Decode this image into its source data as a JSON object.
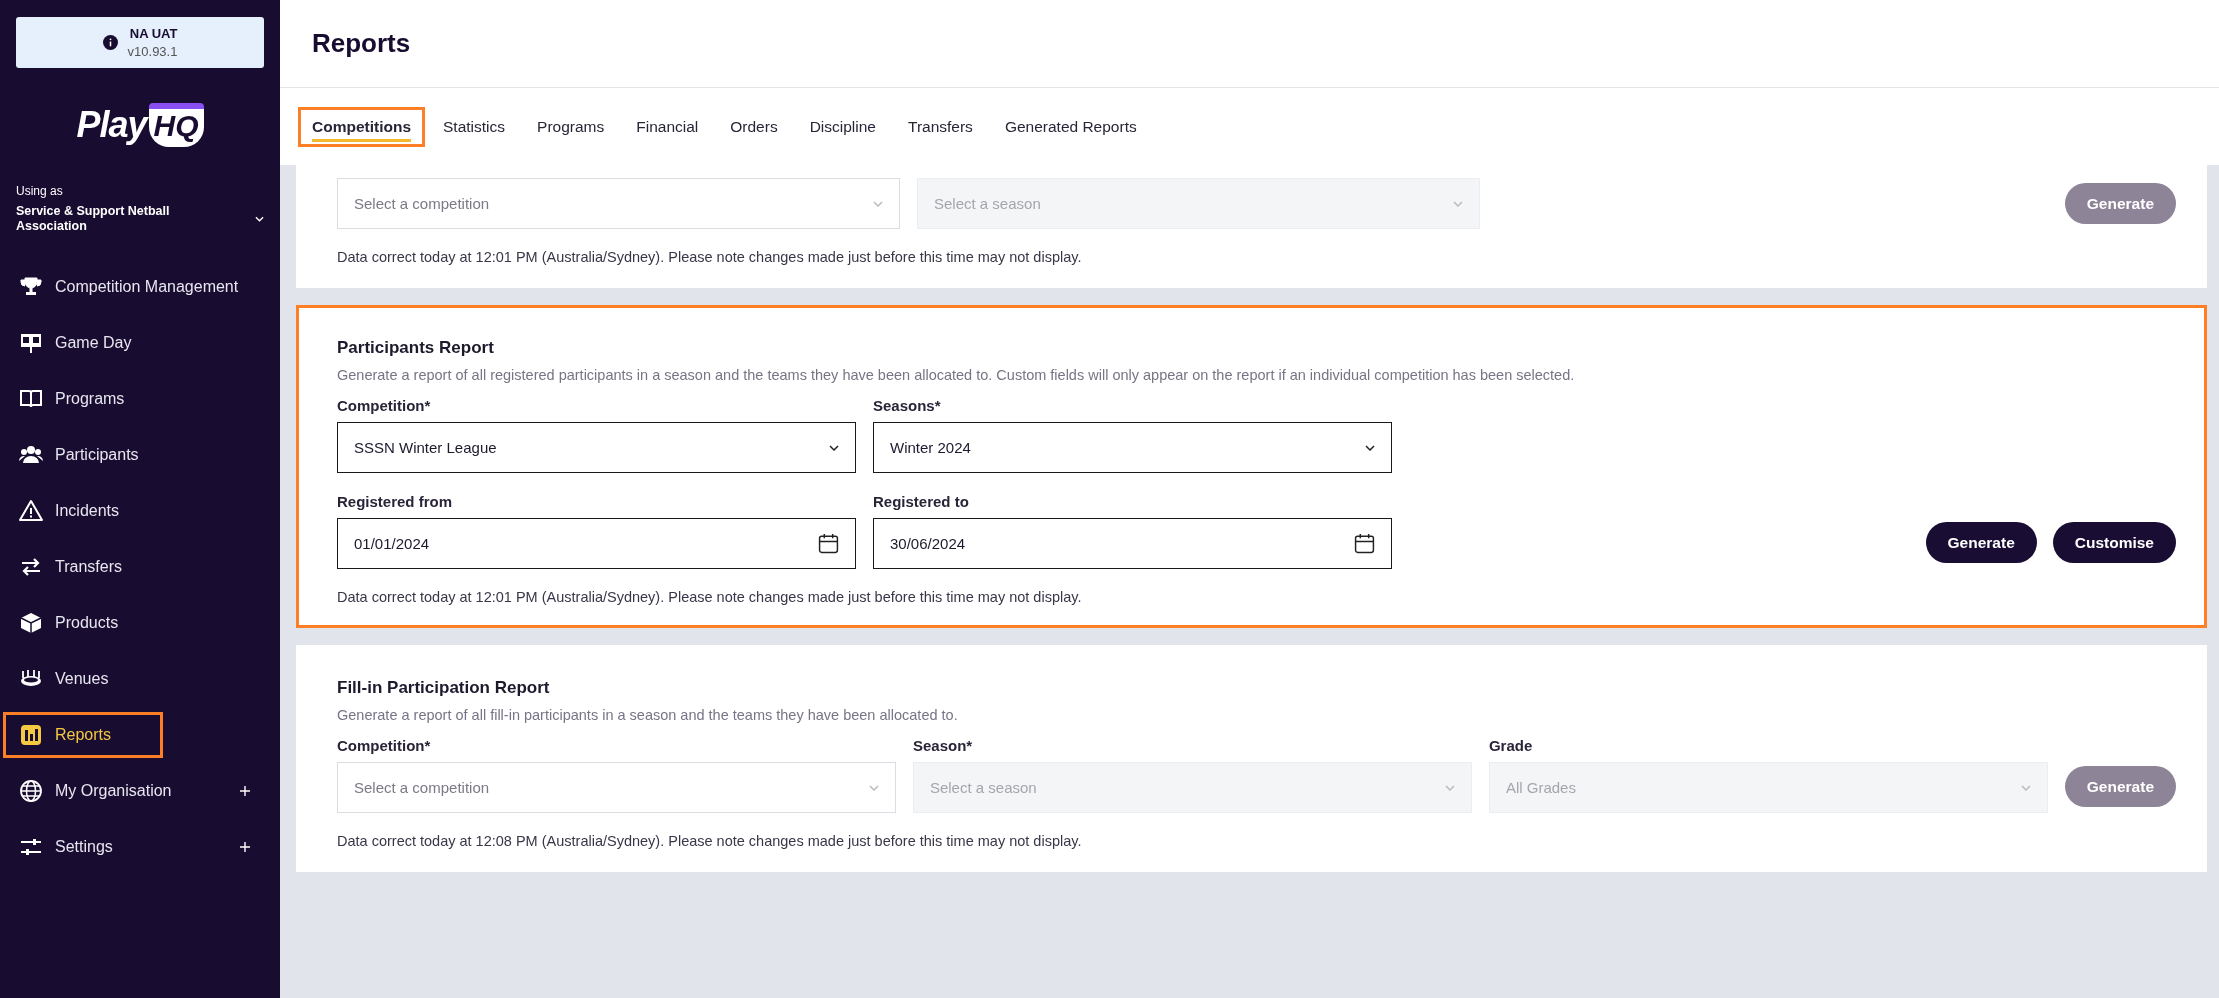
{
  "environment": {
    "name": "NA UAT",
    "version": "v10.93.1"
  },
  "brand": {
    "logo_text": "Play",
    "logo_badge": "HQ"
  },
  "organisation": {
    "caption": "Using as",
    "name": "Service & Support Netball Association"
  },
  "nav": [
    {
      "label": "Competition Management",
      "selected": false,
      "highlighted": false,
      "expandable": false
    },
    {
      "label": "Game Day",
      "selected": false,
      "highlighted": false,
      "expandable": false
    },
    {
      "label": "Programs",
      "selected": false,
      "highlighted": false,
      "expandable": false
    },
    {
      "label": "Participants",
      "selected": false,
      "highlighted": false,
      "expandable": false
    },
    {
      "label": "Incidents",
      "selected": false,
      "highlighted": false,
      "expandable": false
    },
    {
      "label": "Transfers",
      "selected": false,
      "highlighted": false,
      "expandable": false
    },
    {
      "label": "Products",
      "selected": false,
      "highlighted": false,
      "expandable": false
    },
    {
      "label": "Venues",
      "selected": false,
      "highlighted": false,
      "expandable": false
    },
    {
      "label": "Reports",
      "selected": true,
      "highlighted": true,
      "expandable": false
    },
    {
      "label": "My Organisation",
      "selected": false,
      "highlighted": false,
      "expandable": true
    },
    {
      "label": "Settings",
      "selected": false,
      "highlighted": false,
      "expandable": true
    }
  ],
  "page_title": "Reports",
  "tabs": [
    {
      "label": "Competitions",
      "selected": true,
      "highlighted": true
    },
    {
      "label": "Statistics",
      "selected": false,
      "highlighted": false
    },
    {
      "label": "Programs",
      "selected": false,
      "highlighted": false
    },
    {
      "label": "Financial",
      "selected": false,
      "highlighted": false
    },
    {
      "label": "Orders",
      "selected": false,
      "highlighted": false
    },
    {
      "label": "Discipline",
      "selected": false,
      "highlighted": false
    },
    {
      "label": "Transfers",
      "selected": false,
      "highlighted": false
    },
    {
      "label": "Generated Reports",
      "selected": false,
      "highlighted": false
    }
  ],
  "reports": [
    {
      "highlighted": false,
      "rows": [
        [
          {
            "kind": "select",
            "placeholder": "Select a competition",
            "disabled": false
          },
          {
            "kind": "select",
            "placeholder": "Select a season",
            "disabled": true
          }
        ]
      ],
      "buttons": [
        {
          "label": "Generate",
          "disabled": true
        }
      ],
      "note": "Data correct today at 12:01 PM (Australia/Sydney). Please note changes made just before this time may not display."
    },
    {
      "highlighted": true,
      "title": "Participants Report",
      "description": "Generate a report of all registered participants in a season and the teams they have been allocated to. Custom fields will only appear on the report if an individual competition has been selected.",
      "rows": [
        [
          {
            "kind": "select",
            "label": "Competition*",
            "value": "SSSN Winter League",
            "disabled": false
          },
          {
            "kind": "select",
            "label": "Seasons*",
            "value": "Winter 2024",
            "disabled": false
          }
        ],
        [
          {
            "kind": "date",
            "label": "Registered from",
            "value": "01/01/2024",
            "disabled": false
          },
          {
            "kind": "date",
            "label": "Registered to",
            "value": "30/06/2024",
            "disabled": false
          }
        ]
      ],
      "buttons": [
        {
          "label": "Generate",
          "disabled": false
        },
        {
          "label": "Customise",
          "disabled": false
        }
      ],
      "note": "Data correct today at 12:01 PM (Australia/Sydney). Please note changes made just before this time may not display."
    },
    {
      "highlighted": false,
      "title": "Fill-in Participation Report",
      "description": "Generate a report of all fill-in participants in a season and the teams they have been allocated to.",
      "rows": [
        [
          {
            "kind": "select",
            "label": "Competition*",
            "placeholder": "Select a competition",
            "disabled": false
          },
          {
            "kind": "select",
            "label": "Season*",
            "placeholder": "Select a season",
            "disabled": true
          },
          {
            "kind": "select",
            "label": "Grade",
            "placeholder": "All Grades",
            "disabled": true
          }
        ]
      ],
      "buttons": [
        {
          "label": "Generate",
          "disabled": true
        }
      ],
      "note": "Data correct today at 12:08 PM (Australia/Sydney). Please note changes made just before this time may not display."
    }
  ]
}
